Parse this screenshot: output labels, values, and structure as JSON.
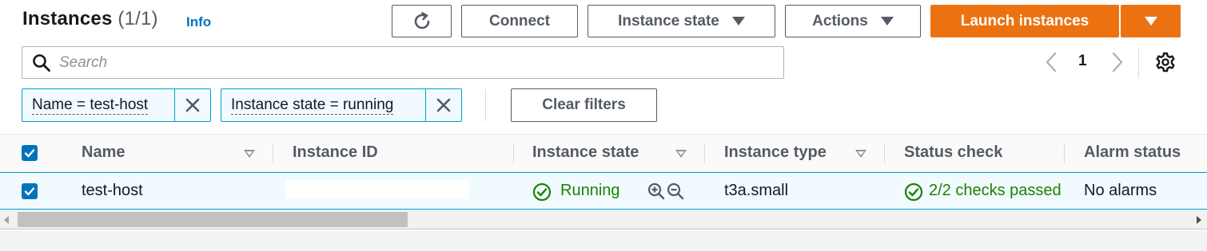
{
  "header": {
    "title": "Instances",
    "count": "(1/1)",
    "info_label": "Info"
  },
  "toolbar": {
    "refresh_icon": "refresh-icon",
    "connect_label": "Connect",
    "instance_state_label": "Instance state",
    "actions_label": "Actions",
    "launch_label": "Launch instances"
  },
  "search": {
    "placeholder": "Search",
    "value": ""
  },
  "pagination": {
    "current_page": "1"
  },
  "filters": [
    {
      "label": "Name = test-host"
    },
    {
      "label": "Instance state = running"
    }
  ],
  "clear_filters_label": "Clear filters",
  "table": {
    "columns": [
      "Name",
      "Instance ID",
      "Instance state",
      "Instance type",
      "Status check",
      "Alarm status"
    ],
    "rows": [
      {
        "selected": true,
        "name": "test-host",
        "instance_id": "",
        "instance_state": "Running",
        "instance_type": "t3a.small",
        "status_check": "2/2 checks passed",
        "alarm_status": "No alarms"
      }
    ]
  },
  "colors": {
    "primary": "#ec7211",
    "link": "#0073bb",
    "success": "#1d8102",
    "selected_row_border": "#00a1c9"
  }
}
